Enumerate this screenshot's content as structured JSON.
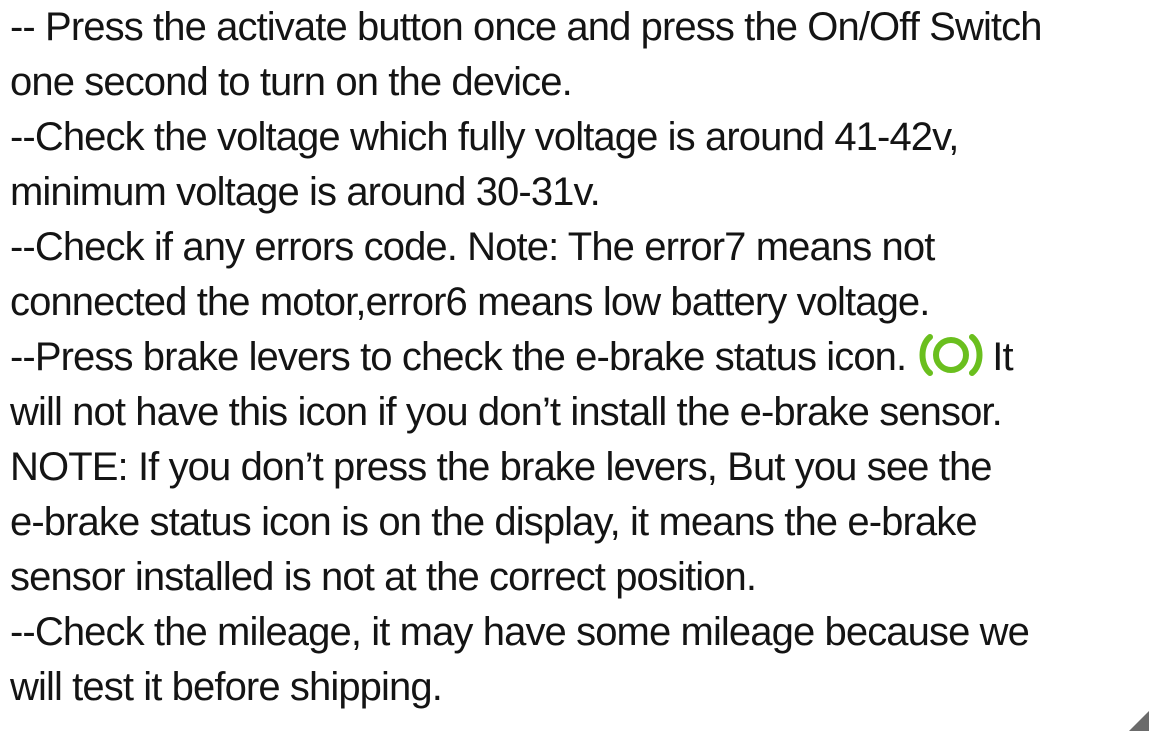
{
  "lines": [
    "-- Press the activate button once and press the On/Off Switch",
    "one second to turn on the device.",
    "--Check the voltage which fully voltage is around 41-42v,",
    "minimum voltage is around 30-31v.",
    "--Check if any errors code. Note: The error7 means not",
    "connected the motor,error6 means low battery voltage.",
    "--Press brake levers to check the e-brake status icon.",
    "It",
    "will not have this icon if you don’t install the e-brake sensor.",
    "NOTE: If you don’t press the brake levers, But you see the",
    "e-brake status icon is on the display, it means the e-brake",
    "sensor installed is not at the correct position.",
    "--Check the mileage, it may have some mileage because we",
    "will test it before shipping."
  ],
  "icons": {
    "brake_status": "e-brake-status-icon",
    "corner": "resize-corner-icon"
  },
  "colors": {
    "text": "#141414",
    "icon_green": "#6abf1e",
    "corner": "#6b6b6b",
    "background": "#ffffff"
  }
}
